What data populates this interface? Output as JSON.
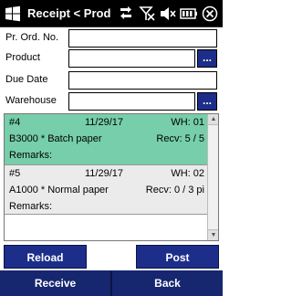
{
  "titlebar": {
    "title": "Receipt < Prod"
  },
  "icons": [
    "windows-logo",
    "data-transfer-icon",
    "no-signal-icon",
    "speaker-muted-icon",
    "battery-icon",
    "close-icon"
  ],
  "form": {
    "fields": [
      {
        "label": "Pr. Ord. No.",
        "value": "",
        "has_lookup": false
      },
      {
        "label": "Product",
        "value": "",
        "has_lookup": true
      },
      {
        "label": "Due Date",
        "value": "",
        "has_lookup": false
      },
      {
        "label": "Warehouse",
        "value": "",
        "has_lookup": true
      }
    ],
    "lookup_label": "..."
  },
  "list": {
    "items": [
      {
        "number": "#4",
        "date": "11/29/17",
        "wh": "WH: 01",
        "product": "B3000 * Batch paper",
        "recv": "Recv: 5 / 5",
        "remarks": "Remarks:",
        "selected": true
      },
      {
        "number": "#5",
        "date": "11/29/17",
        "wh": "WH: 02",
        "product": "A1000 * Normal paper",
        "recv": "Recv: 0 / 3 pi",
        "remarks": "Remarks:",
        "selected": false
      }
    ]
  },
  "buttons": {
    "reload": "Reload",
    "post": "Post"
  },
  "softkeys": {
    "left": "Receive",
    "right": "Back"
  },
  "colors": {
    "titlebar": "#000000",
    "button": "#1c2e8a",
    "selected_row": "#76ceaa",
    "normal_row": "#ebebeb"
  }
}
